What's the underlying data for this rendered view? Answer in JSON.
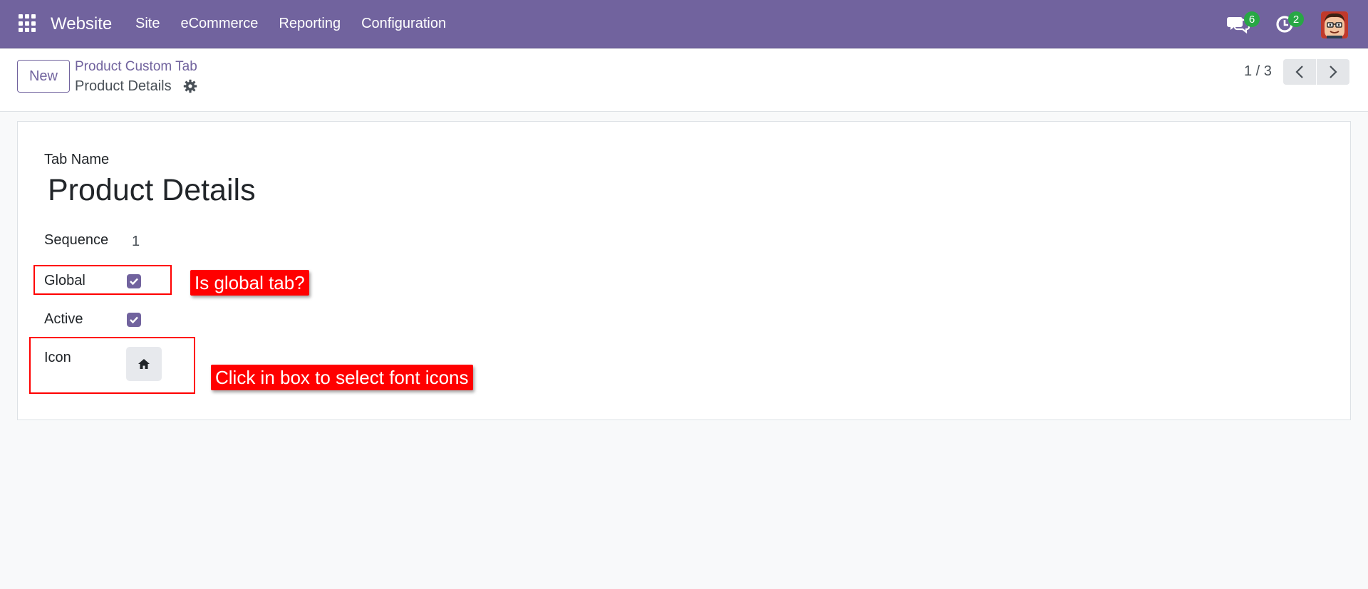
{
  "navbar": {
    "brand": "Website",
    "menu": [
      "Site",
      "eCommerce",
      "Reporting",
      "Configuration"
    ],
    "messages_badge": "6",
    "activities_badge": "2",
    "bg_color": "#71639e"
  },
  "control_panel": {
    "new_label": "New",
    "breadcrumb_parent": "Product Custom Tab",
    "breadcrumb_current": "Product Details",
    "pager_value": "1 / 3"
  },
  "form": {
    "tab_name_label": "Tab Name",
    "tab_name_value": "Product Details",
    "sequence_label": "Sequence",
    "sequence_value": "1",
    "global_label": "Global",
    "global_checked": true,
    "active_label": "Active",
    "active_checked": true,
    "icon_label": "Icon",
    "icon_value": "home-icon"
  },
  "annotations": {
    "global_callout": "Is global tab?",
    "icon_callout": "Click in box to select font icons",
    "color": "#ff0000"
  }
}
